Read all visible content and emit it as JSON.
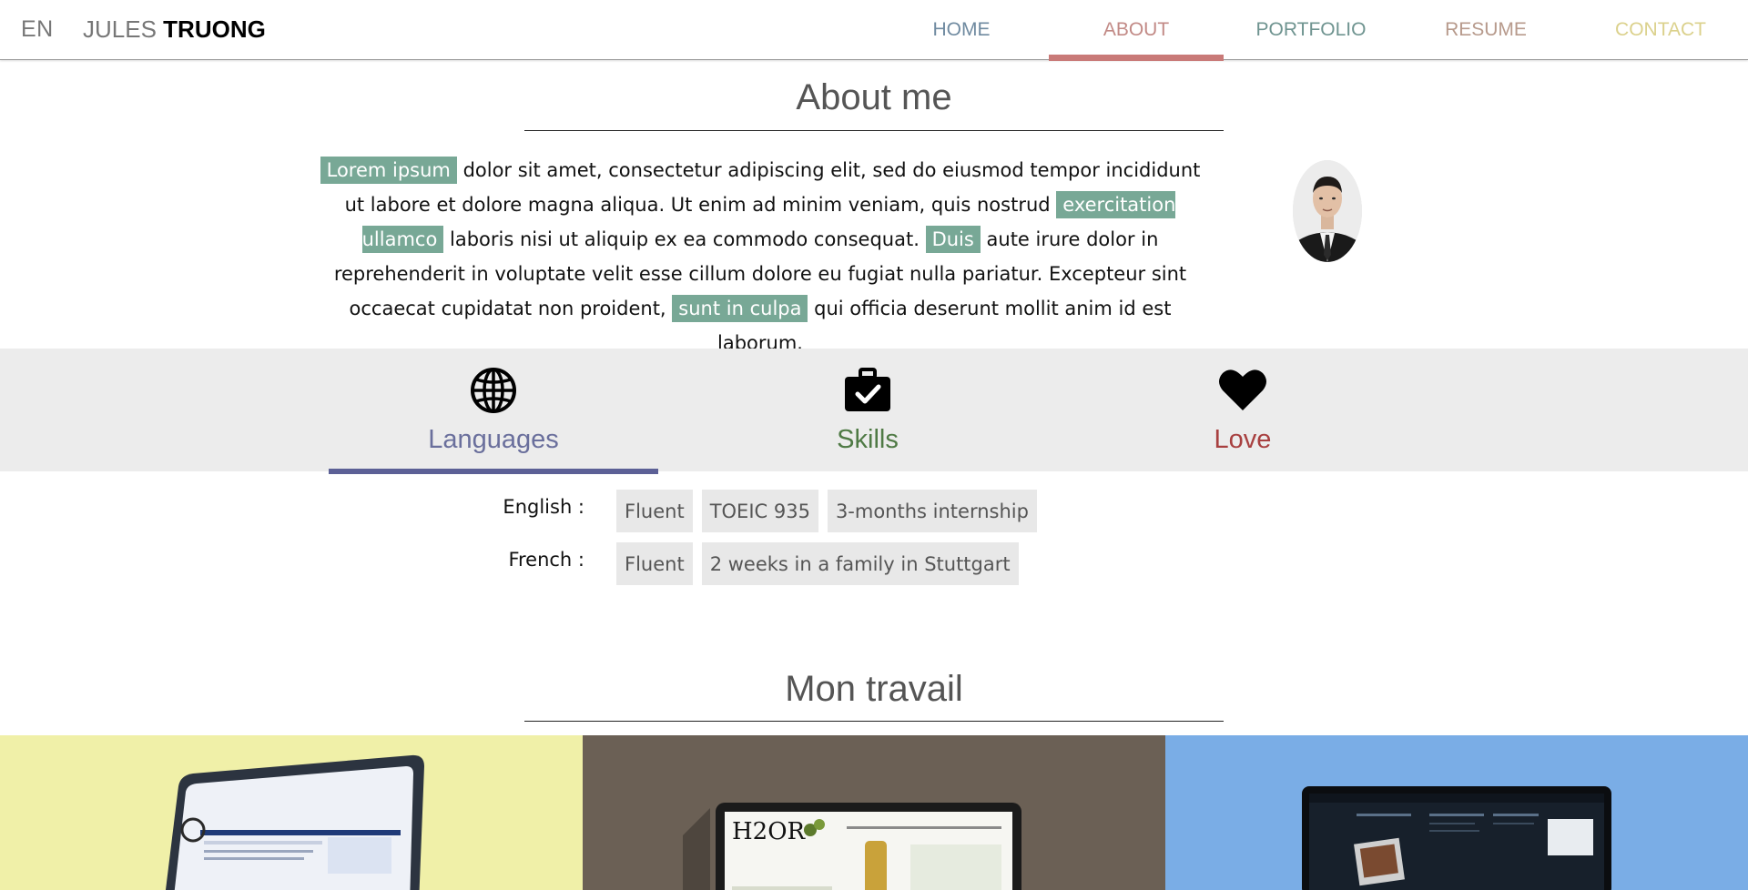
{
  "header": {
    "lang": "EN",
    "brand_first": "JULES",
    "brand_last": "TRUONG",
    "nav": [
      {
        "label": "HOME",
        "color": "#6f8aa0",
        "active": false
      },
      {
        "label": "ABOUT",
        "color": "#c28a86",
        "active": true,
        "bar_color": "#c97a78"
      },
      {
        "label": "PORTFOLIO",
        "color": "#6f9490",
        "active": false
      },
      {
        "label": "RESUME",
        "color": "#b79a8c",
        "active": false
      },
      {
        "label": "CONTACT",
        "color": "#dbd18c",
        "active": false
      }
    ]
  },
  "about": {
    "title": "About me",
    "text": [
      {
        "t": "Lorem ipsum",
        "hl": true
      },
      {
        "t": " dolor sit amet, consectetur adipiscing elit, sed do eiusmod tempor incididunt ut labore et dolore magna aliqua. Ut enim ad minim veniam, quis nostrud ",
        "hl": false
      },
      {
        "t": "exercitation ullamco",
        "hl": true
      },
      {
        "t": " laboris nisi ut aliquip ex ea commodo consequat. ",
        "hl": false
      },
      {
        "t": "Duis",
        "hl": true
      },
      {
        "t": " aute irure dolor in reprehenderit in voluptate velit esse cillum dolore eu fugiat nulla pariatur. Excepteur sint occaecat cupidatat non proident, ",
        "hl": false
      },
      {
        "t": "sunt in culpa",
        "hl": true
      },
      {
        "t": " qui officia deserunt mollit anim id est laborum.",
        "hl": false
      }
    ],
    "highlight_color": "#78a896"
  },
  "tabs": [
    {
      "label": "Languages",
      "icon": "globe-icon",
      "color": "#6a6f9c",
      "active": true,
      "underline_color": "#5c6096"
    },
    {
      "label": "Skills",
      "icon": "briefcase-check-icon",
      "color": "#4f7a45",
      "active": false
    },
    {
      "label": "Love",
      "icon": "heart-icon",
      "color": "#a84040",
      "active": false
    }
  ],
  "languages": [
    {
      "label": "English :",
      "chips": [
        "Fluent",
        "TOEIC 935",
        "3-months internship"
      ]
    },
    {
      "label": "French :",
      "chips": [
        "Fluent",
        "2 weeks in a family in Stuttgart"
      ]
    }
  ],
  "work": {
    "title": "Mon travail",
    "tiles": [
      {
        "name": "osmoz",
        "bg": "#f0f0a8"
      },
      {
        "name": "h2or",
        "bg": "#6b6055"
      },
      {
        "name": "dark-site",
        "bg": "#7aade6"
      }
    ]
  }
}
